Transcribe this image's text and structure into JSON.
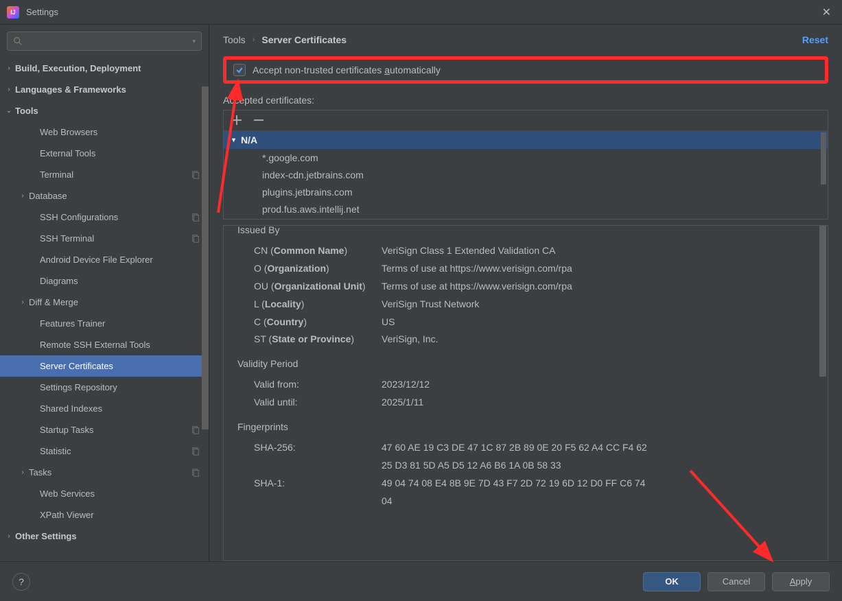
{
  "window": {
    "title": "Settings"
  },
  "search": {
    "placeholder": ""
  },
  "reset_label": "Reset",
  "breadcrumbs": {
    "parent": "Tools",
    "current": "Server Certificates"
  },
  "checkbox": {
    "label_pre": "Accept non-trusted certificates ",
    "label_underlined": "a",
    "label_post": "utomatically",
    "checked": true
  },
  "accepted_label": "Accepted certificates:",
  "cert_group": "N/A",
  "certs": [
    "*.google.com",
    "index-cdn.jetbrains.com",
    "plugins.jetbrains.com",
    "prod.fus.aws.intellij.net"
  ],
  "details": {
    "issued_by": "Issued By",
    "fields": [
      {
        "short": "CN",
        "long": "Common Name",
        "value": "VeriSign Class 1 Extended Validation CA"
      },
      {
        "short": "O",
        "long": "Organization",
        "value": "Terms of use at https://www.verisign.com/rpa"
      },
      {
        "short": "OU",
        "long": "Organizational Unit",
        "value": "Terms of use at https://www.verisign.com/rpa"
      },
      {
        "short": "L",
        "long": "Locality",
        "value": "VeriSign Trust Network"
      },
      {
        "short": "C",
        "long": "Country",
        "value": "US"
      },
      {
        "short": "ST",
        "long": "State or Province",
        "value": "VeriSign, Inc."
      }
    ],
    "validity_header": "Validity Period",
    "valid_from_label": "Valid from:",
    "valid_from": "2023/12/12",
    "valid_until_label": "Valid until:",
    "valid_until": "2025/1/11",
    "fingerprints_header": "Fingerprints",
    "sha256_label": "SHA-256:",
    "sha256": "47 60 AE 19 C3 DE 47 1C 87 2B 89 0E 20 F5 62 A4 CC F4 62 25 D3 81 5D A5 D5 12 A6 B6 1A 0B 58 33",
    "sha1_label": "SHA-1:",
    "sha1": "49 04 74 08 E4 8B 9E 7D 43 F7 2D 72 19 6D 12 D0 FF C6 74 04"
  },
  "sidebar": [
    {
      "label": "Build, Execution, Deployment",
      "lvl": 0,
      "bold": true,
      "chev": "›"
    },
    {
      "label": "Languages & Frameworks",
      "lvl": 0,
      "bold": true,
      "chev": "›"
    },
    {
      "label": "Tools",
      "lvl": 0,
      "bold": true,
      "chev": "⌄"
    },
    {
      "label": "Web Browsers",
      "lvl": 2
    },
    {
      "label": "External Tools",
      "lvl": 2
    },
    {
      "label": "Terminal",
      "lvl": 2,
      "copy": true
    },
    {
      "label": "Database",
      "lvl": 1,
      "chev": "›"
    },
    {
      "label": "SSH Configurations",
      "lvl": 2,
      "copy": true
    },
    {
      "label": "SSH Terminal",
      "lvl": 2,
      "copy": true
    },
    {
      "label": "Android Device File Explorer",
      "lvl": 2
    },
    {
      "label": "Diagrams",
      "lvl": 2
    },
    {
      "label": "Diff & Merge",
      "lvl": 1,
      "chev": "›"
    },
    {
      "label": "Features Trainer",
      "lvl": 2
    },
    {
      "label": "Remote SSH External Tools",
      "lvl": 2
    },
    {
      "label": "Server Certificates",
      "lvl": 2,
      "selected": true
    },
    {
      "label": "Settings Repository",
      "lvl": 2
    },
    {
      "label": "Shared Indexes",
      "lvl": 2
    },
    {
      "label": "Startup Tasks",
      "lvl": 2,
      "copy": true
    },
    {
      "label": "Statistic",
      "lvl": 2,
      "copy": true
    },
    {
      "label": "Tasks",
      "lvl": 1,
      "chev": "›",
      "copy": true
    },
    {
      "label": "Web Services",
      "lvl": 2
    },
    {
      "label": "XPath Viewer",
      "lvl": 2
    },
    {
      "label": "Other Settings",
      "lvl": 0,
      "bold": true,
      "chev": "›"
    }
  ],
  "buttons": {
    "ok": "OK",
    "cancel": "Cancel",
    "apply": "Apply"
  }
}
